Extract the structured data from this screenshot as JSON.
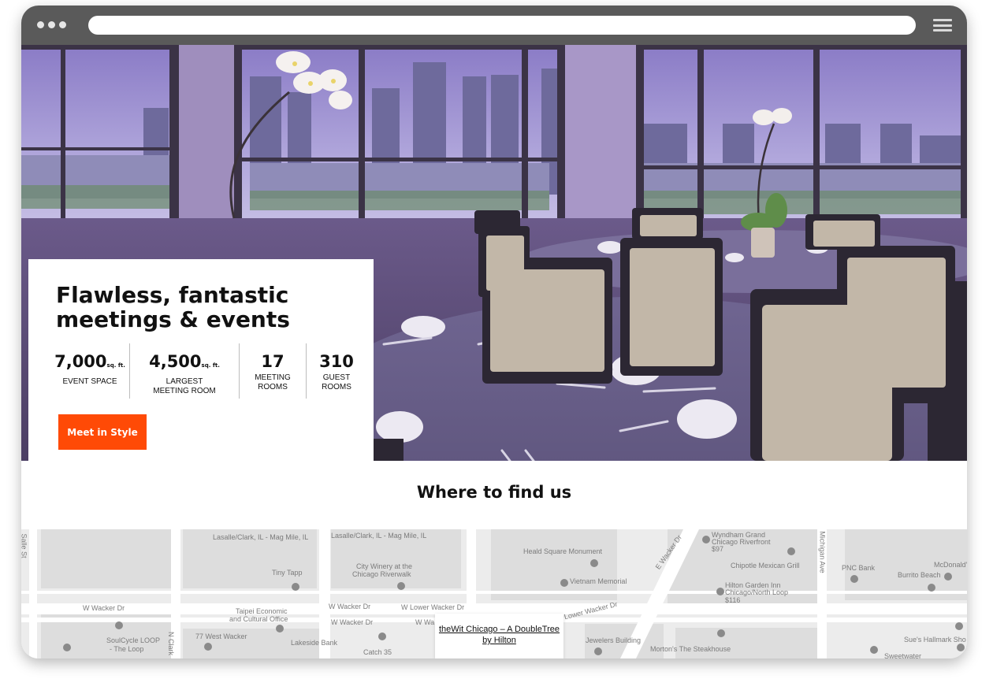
{
  "browser": {
    "address_value": ""
  },
  "hero": {
    "headline": "Flawless, fantastic meetings & events",
    "stats": [
      {
        "value": "7,000",
        "unit": "sq. ft.",
        "label": "EVENT SPACE"
      },
      {
        "value": "4,500",
        "unit": "sq. ft.",
        "label": "LARGEST MEETING ROOM"
      },
      {
        "value": "17",
        "unit": "",
        "label": "MEETING ROOMS"
      },
      {
        "value": "310",
        "unit": "",
        "label": "GUEST ROOMS"
      }
    ],
    "cta_label": "Meet in Style"
  },
  "location": {
    "heading": "Where to find us",
    "map_labels": [
      "Lasalle/Clark, IL - Mag Mile, IL",
      "Lasalle/Clark, IL - Mag Mile, IL",
      "Tiny Tapp",
      "City Winery at the",
      "Chicago Riverwalk",
      "Heald Square Monument",
      "Vietnam Memorial",
      "E Wacker Dr",
      "Wyndham Grand",
      "Chicago Riverfront",
      "Chipotle Mexican Grill",
      "Hilton Garden Inn",
      "Chicago/North Loop",
      "PNC Bank",
      "McDonald's",
      "Burrito Beach",
      "W Wacker Dr",
      "Taipei Economic",
      "and Cultural Office",
      "W Wacker Dr",
      "W Lower Wacker Dr",
      "W Wacker Dr",
      "W Wa",
      "Lower Wacker Dr",
      "SoulCycle LOOP",
      "- The Loop",
      "77 West Wacker",
      "Lakeside Bank",
      "Catch 35",
      "Jewelers Building",
      "Morton's The Steakhouse",
      "Sue's Hallmark Sho",
      "Sweetwater",
      "N Clark",
      "Michigan Ave",
      "Salle St",
      "$97",
      "$116"
    ],
    "map_popup_link": "theWit Chicago – A DoubleTree by Hilton"
  }
}
